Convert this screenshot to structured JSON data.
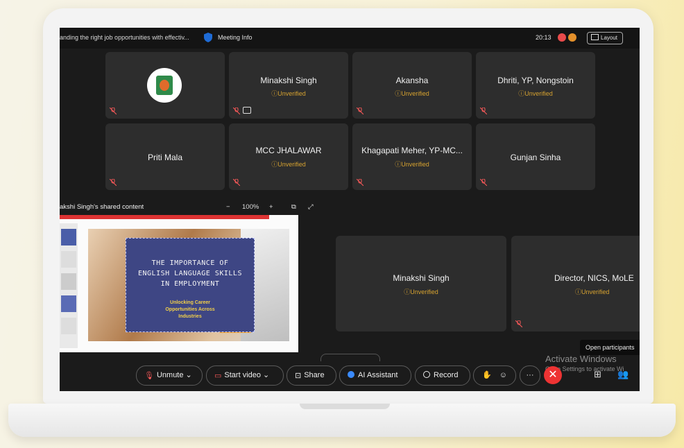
{
  "topbar": {
    "meeting_title": "anding the right job opportunities with effectiv...",
    "meeting_info": "Meeting Info",
    "time": "20:13",
    "layout_label": "Layout"
  },
  "participants_grid": [
    {
      "name": "",
      "status": "",
      "logo": true
    },
    {
      "name": "Minakshi Singh",
      "status": "Unverified"
    },
    {
      "name": "Akansha",
      "status": "Unverified"
    },
    {
      "name": "Dhriti, YP, Nongstoin",
      "status": "Unverified"
    },
    {
      "name": "Priti Mala",
      "status": ""
    },
    {
      "name": "MCC JHALAWAR",
      "status": "Unverified"
    },
    {
      "name": "Khagapati Meher, YP-MC...",
      "status": "Unverified"
    },
    {
      "name": "Gunjan Sinha",
      "status": ""
    }
  ],
  "shared_content": {
    "label": "akshi Singh's shared content",
    "zoom_minus": "−",
    "zoom_level": "100%",
    "zoom_plus": "+"
  },
  "slide": {
    "title_line1": "THE IMPORTANCE OF",
    "title_line2": "ENGLISH LANGUAGE SKILLS",
    "title_line3": "IN EMPLOYMENT",
    "subtitle_line1": "Unlocking Career",
    "subtitle_line2": "Opportunities Across",
    "subtitle_line3": "Industries"
  },
  "stage_participants": [
    {
      "name": "Minakshi Singh",
      "status": "Unverified"
    },
    {
      "name": "Director, NICS, MoLE",
      "status": "Unverified"
    }
  ],
  "toolbar": {
    "unmute": "Unmute",
    "start_video": "Start video",
    "share": "Share",
    "ai_assistant": "AI Assistant",
    "record": "Record",
    "more": "···",
    "end": "✕"
  },
  "overlay": {
    "tooltip": "Open participants",
    "activate_title": "Activate Windows",
    "activate_sub": "Go to Settings to activate Wi"
  },
  "colors": {
    "unverified": "#d6a230",
    "end_call": "#e33333",
    "screen_bg": "#1b1b1b",
    "tile_bg": "#2d2d2d"
  }
}
